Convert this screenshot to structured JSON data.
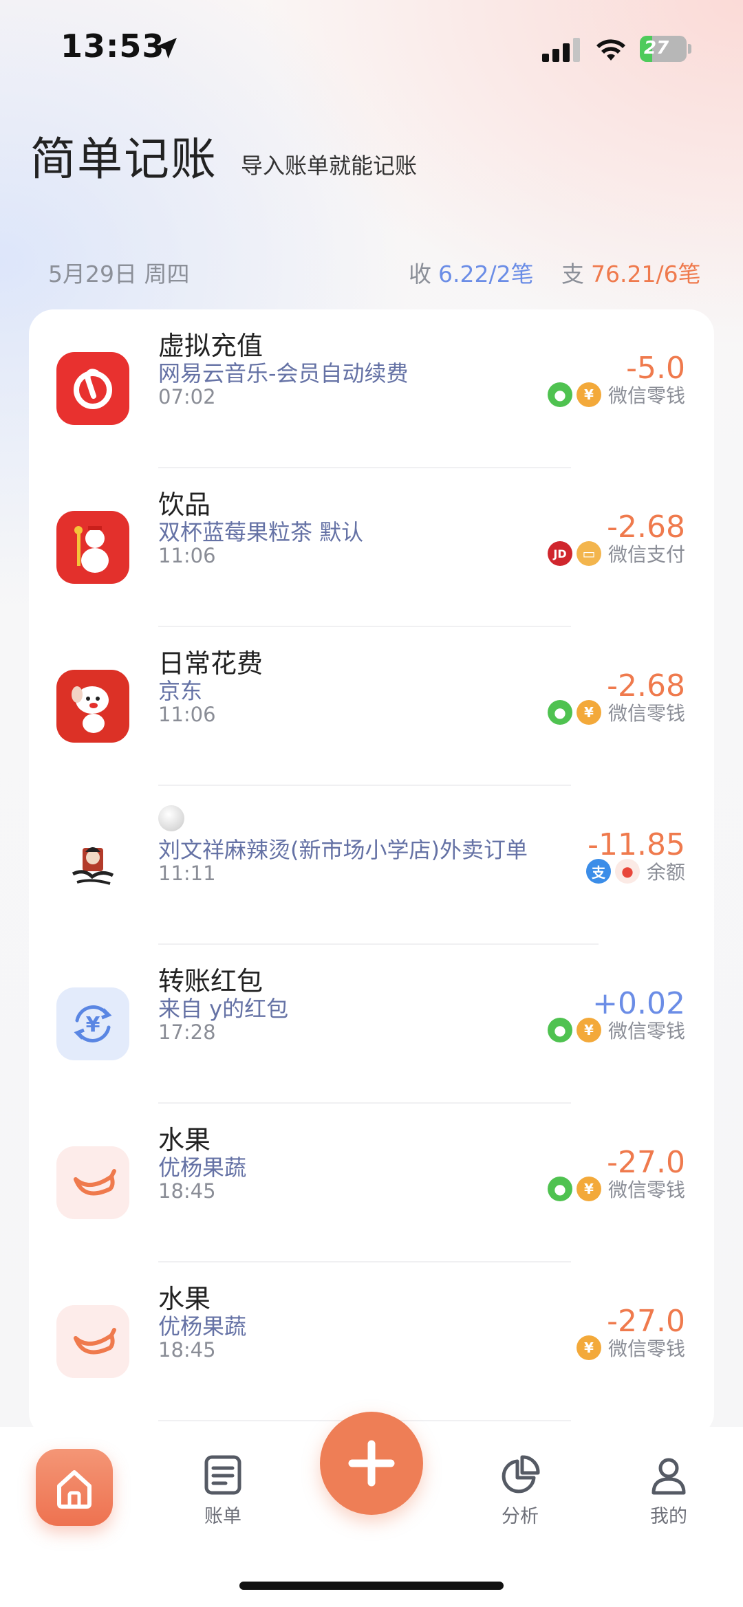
{
  "status_bar": {
    "time": "13:53",
    "battery": "27",
    "battery_level": 0.27
  },
  "header": {
    "title": "简单记账",
    "subtitle": "导入账单就能记账"
  },
  "day_summary": {
    "date": "5月29日 周四",
    "income_label": "收",
    "income_value": "6.22/2笔",
    "expense_label": "支",
    "expense_value": "76.21/6笔"
  },
  "transactions": [
    {
      "category": "虚拟充值",
      "description": "网易云音乐-会员自动续费",
      "time": "07:02",
      "amount": "-5.0",
      "payment": "微信零钱",
      "icon": "netease-music-icon",
      "pay_icons": [
        "wechat-icon",
        "wechat-change-icon"
      ]
    },
    {
      "category": "饮品",
      "description": "双杯蓝莓果粒茶 默认",
      "time": "11:06",
      "amount": "-2.68",
      "payment": "微信支付",
      "icon": "mixue-icon",
      "pay_icons": [
        "jd-icon",
        "wechat-pay-card-icon"
      ]
    },
    {
      "category": "日常花费",
      "description": "京东",
      "time": "11:06",
      "amount": "-2.68",
      "payment": "微信零钱",
      "icon": "jd-dog-icon",
      "pay_icons": [
        "wechat-icon",
        "wechat-change-icon"
      ]
    },
    {
      "category": "",
      "description": "刘文祥麻辣烫(新市场小学店)外卖订单",
      "time": "11:11",
      "amount": "-11.85",
      "payment": "余额",
      "icon": "liuwenxiang-logo-icon",
      "pay_icons": [
        "alipay-icon",
        "balance-icon"
      ]
    },
    {
      "category": "转账红包",
      "description": "来自 y的红包",
      "time": "17:28",
      "amount": "+0.02",
      "payment": "微信零钱",
      "icon": "yuan-transfer-icon",
      "pay_icons": [
        "wechat-icon",
        "wechat-change-icon"
      ]
    },
    {
      "category": "水果",
      "description": "优杨果蔬",
      "time": "18:45",
      "amount": "-27.0",
      "payment": "微信零钱",
      "icon": "banana-icon",
      "pay_icons": [
        "wechat-icon",
        "wechat-change-icon"
      ]
    },
    {
      "category": "水果",
      "description": "优杨果蔬",
      "time": "18:45",
      "amount": "-27.0",
      "payment": "微信零钱",
      "icon": "banana-icon",
      "pay_icons": [
        "wechat-change-icon"
      ]
    }
  ],
  "bottom_nav": {
    "home": "home-icon",
    "bills_label": "账单",
    "add": "plus-icon",
    "analysis_label": "分析",
    "mine_label": "我的"
  },
  "colors": {
    "accent": "#ee7e56",
    "expense": "#ef7a4d",
    "income": "#6b8de6",
    "desc": "#6572a5"
  }
}
